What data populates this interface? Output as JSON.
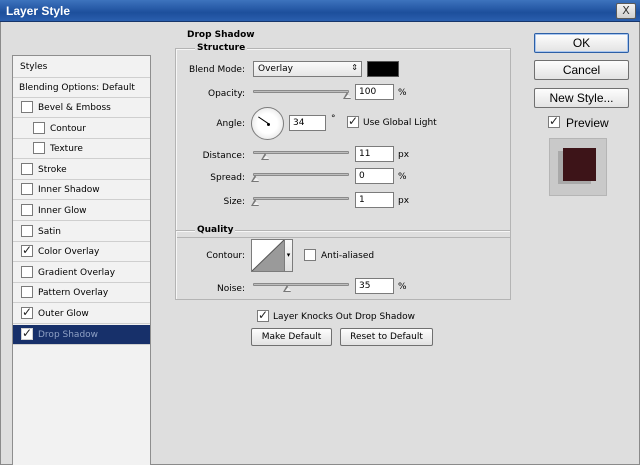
{
  "window": {
    "title": "Layer Style",
    "close_glyph": "X"
  },
  "sidebar": {
    "header": "Styles",
    "blending": "Blending Options: Default",
    "items": [
      {
        "label": "Bevel & Emboss",
        "checked": false
      },
      {
        "label": "Contour",
        "checked": false
      },
      {
        "label": "Texture",
        "checked": false
      },
      {
        "label": "Stroke",
        "checked": false
      },
      {
        "label": "Inner Shadow",
        "checked": false
      },
      {
        "label": "Inner Glow",
        "checked": false
      },
      {
        "label": "Satin",
        "checked": false
      },
      {
        "label": "Color Overlay",
        "checked": true
      },
      {
        "label": "Gradient Overlay",
        "checked": false
      },
      {
        "label": "Pattern Overlay",
        "checked": false
      },
      {
        "label": "Outer Glow",
        "checked": true
      },
      {
        "label": "Drop Shadow",
        "checked": true,
        "selected": true
      }
    ]
  },
  "panel": {
    "group_title": "Drop Shadow",
    "structure_title": "Structure",
    "blend_mode_label": "Blend Mode:",
    "blend_mode_value": "Overlay",
    "shadow_color": "#000000",
    "opacity_label": "Opacity:",
    "opacity_value": "100",
    "opacity_unit": "%",
    "angle_label": "Angle:",
    "angle_value": "34",
    "angle_unit": "°",
    "use_global_light_label": "Use Global Light",
    "use_global_light": true,
    "distance_label": "Distance:",
    "distance_value": "11",
    "distance_unit": "px",
    "spread_label": "Spread:",
    "spread_value": "0",
    "spread_unit": "%",
    "size_label": "Size:",
    "size_value": "1",
    "size_unit": "px",
    "quality_title": "Quality",
    "contour_label": "Contour:",
    "anti_aliased_label": "Anti-aliased",
    "anti_aliased": false,
    "noise_label": "Noise:",
    "noise_value": "35",
    "noise_unit": "%",
    "knockout_label": "Layer Knocks Out Drop Shadow",
    "knockout": true,
    "make_default_label": "Make Default",
    "reset_default_label": "Reset to Default"
  },
  "buttons": {
    "ok": "OK",
    "cancel": "Cancel",
    "new_style": "New Style...",
    "preview_label": "Preview",
    "preview_checked": true,
    "preview_swatch_color": "#3d1418"
  }
}
